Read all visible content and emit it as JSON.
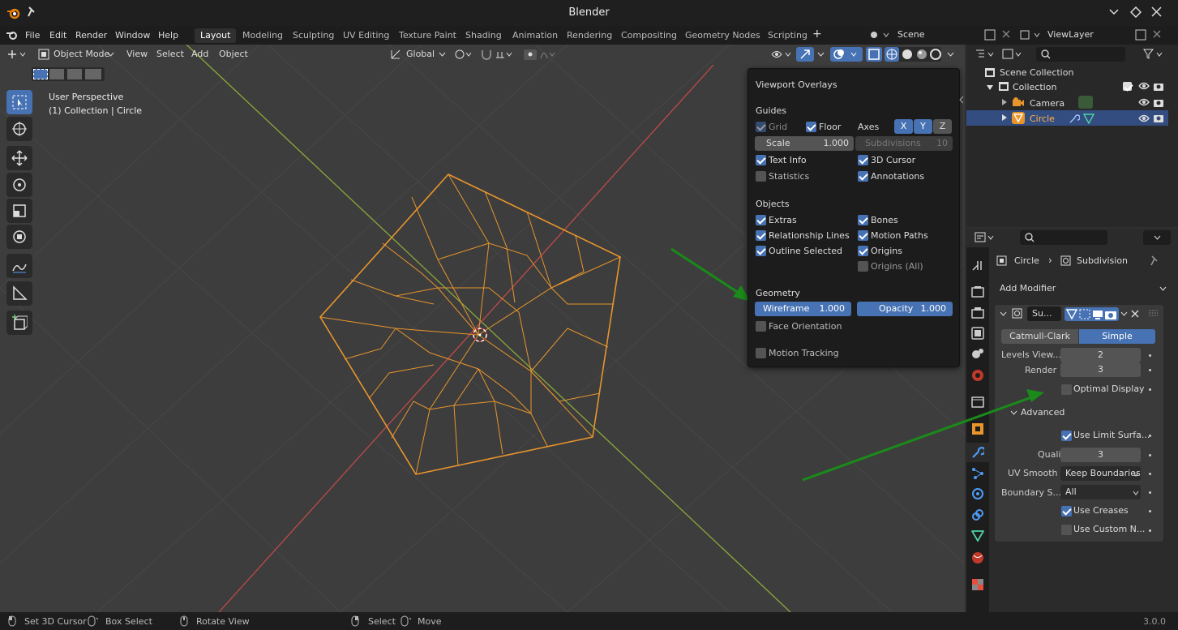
{
  "app": {
    "title": "Blender",
    "version": "3.0.0"
  },
  "menu": {
    "items": [
      "File",
      "Edit",
      "Render",
      "Window",
      "Help"
    ]
  },
  "workspaces": [
    "Layout",
    "Modeling",
    "Sculpting",
    "UV Editing",
    "Texture Paint",
    "Shading",
    "Animation",
    "Rendering",
    "Compositing",
    "Geometry Nodes",
    "Scripting"
  ],
  "workspace_active": "Layout",
  "scene": "Scene",
  "view_layer": "ViewLayer",
  "viewport_header": {
    "mode": "Object Mode",
    "menus": [
      "View",
      "Select",
      "Add",
      "Object"
    ],
    "transform": "Global"
  },
  "viewport_info": {
    "line1": "User Perspective",
    "line2": "(1) Collection | Circle"
  },
  "overlays": {
    "title": "Viewport Overlays",
    "guides_title": "Guides",
    "grid": "Grid",
    "floor": "Floor",
    "axes": "Axes",
    "x": "X",
    "y": "Y",
    "z": "Z",
    "scale_label": "Scale",
    "scale_value": "1.000",
    "subdivisions_label": "Subdivisions",
    "subdivisions_value": "10",
    "text_info": "Text Info",
    "cursor_3d": "3D Cursor",
    "statistics": "Statistics",
    "annotations": "Annotations",
    "objects_title": "Objects",
    "extras": "Extras",
    "bones": "Bones",
    "relationship_lines": "Relationship Lines",
    "motion_paths": "Motion Paths",
    "outline_selected": "Outline Selected",
    "origins": "Origins",
    "origins_all": "Origins (All)",
    "geometry_title": "Geometry",
    "wireframe_label": "Wireframe",
    "wireframe_value": "1.000",
    "opacity_label": "Opacity",
    "opacity_value": "1.000",
    "face_orientation": "Face Orientation",
    "motion_tracking": "Motion Tracking"
  },
  "outliner": {
    "scene_collection": "Scene Collection",
    "collection": "Collection",
    "camera": "Camera",
    "circle": "Circle"
  },
  "properties": {
    "breadcrumb_object": "Circle",
    "breadcrumb_modifier": "Subdivision",
    "add_modifier": "Add Modifier",
    "modifier_name": "Su...",
    "catmull": "Catmull-Clark",
    "simple": "Simple",
    "levels_viewport_label": "Levels View...",
    "levels_viewport": "2",
    "render_label": "Render",
    "render_value": "3",
    "optimal_display": "Optimal Display",
    "advanced": "Advanced",
    "use_limit_surface": "Use Limit Surfa...",
    "quality_label": "Quality",
    "quality_value": "3",
    "uv_smooth_label": "UV Smooth",
    "uv_smooth_value": "Keep Boundaries",
    "boundary_label": "Boundary S...",
    "boundary_value": "All",
    "use_creases": "Use Creases",
    "use_custom_normals": "Use Custom N..."
  },
  "status": {
    "set_cursor": "Set 3D Cursor",
    "box_select": "Box Select",
    "rotate_view": "Rotate View",
    "select": "Select",
    "move": "Move"
  },
  "colors": {
    "accent": "#4772b3",
    "wire": "#e8952c",
    "annotation_arrow": "#1a8a1a",
    "x_axis": "#c04a4a",
    "y_axis": "#8aa83a"
  }
}
